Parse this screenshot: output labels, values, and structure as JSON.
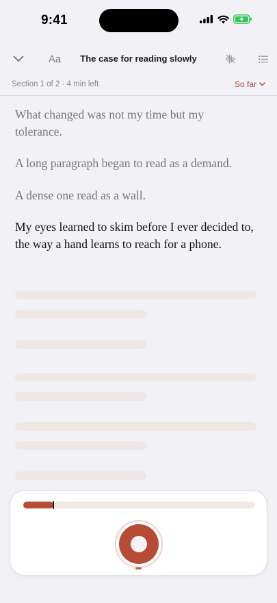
{
  "status_bar": {
    "time": "9:41"
  },
  "header": {
    "font_button_label": "Aa",
    "title": "The case for reading slowly"
  },
  "section": {
    "info": "Section 1 of 2 · 4 min left",
    "so_far_label": "So far"
  },
  "reader": {
    "paragraphs": [
      "What changed was not my time but my tolerance.",
      "A long paragraph began to read as a demand.",
      "A dense one read as a wall.",
      "My eyes learned to skim before I ever decided to, the way a hand learns to reach for a phone."
    ],
    "current_paragraph_index": 3
  },
  "player": {
    "playback_progress": 0.13,
    "state": "playing"
  },
  "colors": {
    "accent": "#b64c35",
    "background": "#f2f1f6",
    "muted_text": "#77767b",
    "skeleton": "#efe7e4",
    "battery": "#34c759"
  },
  "icons": {
    "collapse": "chevron-down-icon",
    "font": "text-size-icon",
    "audio": "waveform-icon",
    "contents": "list-icon",
    "so_far": "chevron-down-icon"
  }
}
